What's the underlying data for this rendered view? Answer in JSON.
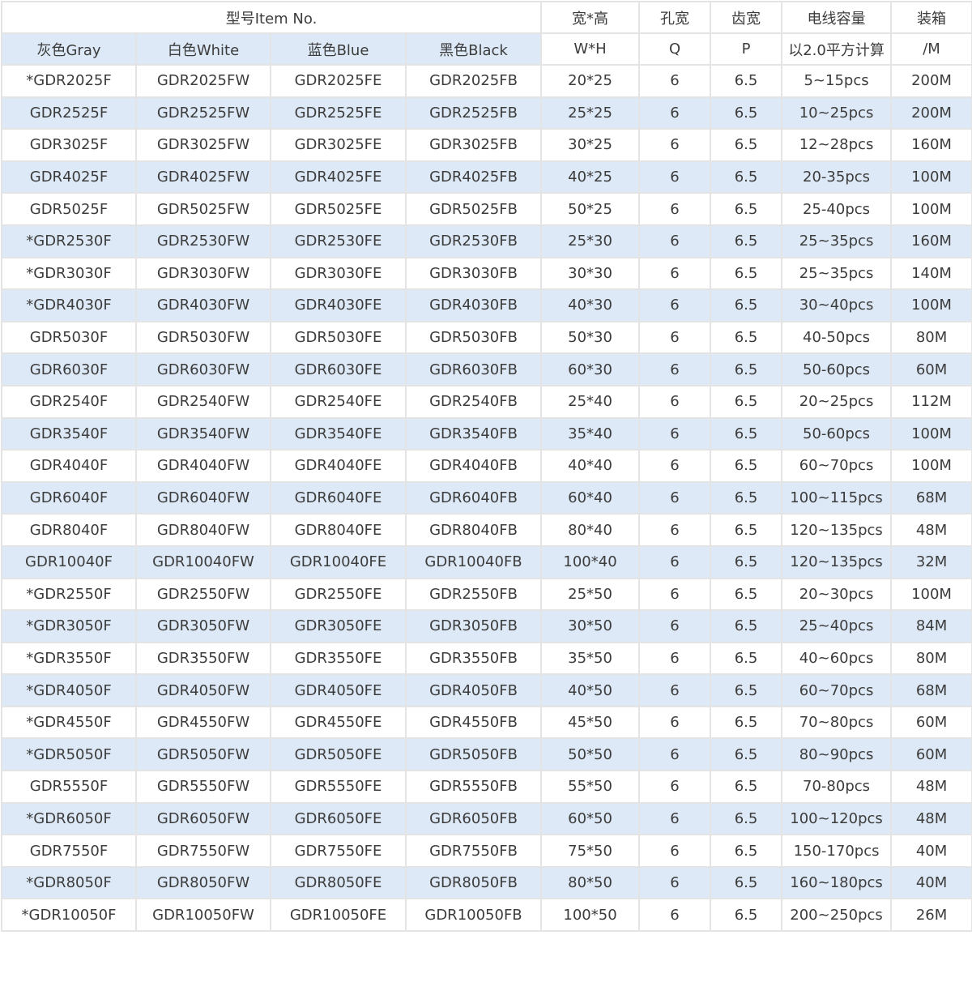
{
  "header": {
    "model_group": "型号Item No.",
    "gray": "灰色Gray",
    "white": "白色White",
    "blue": "蓝色Blue",
    "black": "黑色Black",
    "size_top": "宽*高",
    "size_bottom": "W*H",
    "hole_top": "孔宽",
    "hole_bottom": "Q",
    "tooth_top": "齿宽",
    "tooth_bottom": "P",
    "capacity_top": "电线容量",
    "capacity_bottom": "以2.0平方计算",
    "pack_top": "装箱",
    "pack_bottom": "/M"
  },
  "rows": [
    {
      "gray": "*GDR2025F",
      "white": "GDR2025FW",
      "blue": "GDR2025FE",
      "black": "GDR2025FB",
      "size": "20*25",
      "q": "6",
      "p": "6.5",
      "cap": "5~15pcs",
      "pack": "200M"
    },
    {
      "gray": "GDR2525F",
      "white": "GDR2525FW",
      "blue": "GDR2525FE",
      "black": "GDR2525FB",
      "size": "25*25",
      "q": "6",
      "p": "6.5",
      "cap": "10~25pcs",
      "pack": "200M"
    },
    {
      "gray": "GDR3025F",
      "white": "GDR3025FW",
      "blue": "GDR3025FE",
      "black": "GDR3025FB",
      "size": "30*25",
      "q": "6",
      "p": "6.5",
      "cap": "12~28pcs",
      "pack": "160M"
    },
    {
      "gray": "GDR4025F",
      "white": "GDR4025FW",
      "blue": "GDR4025FE",
      "black": "GDR4025FB",
      "size": "40*25",
      "q": "6",
      "p": "6.5",
      "cap": "20-35pcs",
      "pack": "100M"
    },
    {
      "gray": "GDR5025F",
      "white": "GDR5025FW",
      "blue": "GDR5025FE",
      "black": "GDR5025FB",
      "size": "50*25",
      "q": "6",
      "p": "6.5",
      "cap": "25-40pcs",
      "pack": "100M"
    },
    {
      "gray": "*GDR2530F",
      "white": "GDR2530FW",
      "blue": "GDR2530FE",
      "black": "GDR2530FB",
      "size": "25*30",
      "q": "6",
      "p": "6.5",
      "cap": "25~35pcs",
      "pack": "160M"
    },
    {
      "gray": "*GDR3030F",
      "white": "GDR3030FW",
      "blue": "GDR3030FE",
      "black": "GDR3030FB",
      "size": "30*30",
      "q": "6",
      "p": "6.5",
      "cap": "25~35pcs",
      "pack": "140M"
    },
    {
      "gray": "*GDR4030F",
      "white": "GDR4030FW",
      "blue": "GDR4030FE",
      "black": "GDR4030FB",
      "size": "40*30",
      "q": "6",
      "p": "6.5",
      "cap": "30~40pcs",
      "pack": "100M"
    },
    {
      "gray": "GDR5030F",
      "white": "GDR5030FW",
      "blue": "GDR5030FE",
      "black": "GDR5030FB",
      "size": "50*30",
      "q": "6",
      "p": "6.5",
      "cap": "40-50pcs",
      "pack": "80M"
    },
    {
      "gray": "GDR6030F",
      "white": "GDR6030FW",
      "blue": "GDR6030FE",
      "black": "GDR6030FB",
      "size": "60*30",
      "q": "6",
      "p": "6.5",
      "cap": "50-60pcs",
      "pack": "60M"
    },
    {
      "gray": "GDR2540F",
      "white": "GDR2540FW",
      "blue": "GDR2540FE",
      "black": "GDR2540FB",
      "size": "25*40",
      "q": "6",
      "p": "6.5",
      "cap": "20~25pcs",
      "pack": "112M"
    },
    {
      "gray": "GDR3540F",
      "white": "GDR3540FW",
      "blue": "GDR3540FE",
      "black": "GDR3540FB",
      "size": "35*40",
      "q": "6",
      "p": "6.5",
      "cap": "50-60pcs",
      "pack": "100M"
    },
    {
      "gray": "GDR4040F",
      "white": "GDR4040FW",
      "blue": "GDR4040FE",
      "black": "GDR4040FB",
      "size": "40*40",
      "q": "6",
      "p": "6.5",
      "cap": "60~70pcs",
      "pack": "100M"
    },
    {
      "gray": "GDR6040F",
      "white": "GDR6040FW",
      "blue": "GDR6040FE",
      "black": "GDR6040FB",
      "size": "60*40",
      "q": "6",
      "p": "6.5",
      "cap": "100~115pcs",
      "pack": "68M"
    },
    {
      "gray": "GDR8040F",
      "white": "GDR8040FW",
      "blue": "GDR8040FE",
      "black": "GDR8040FB",
      "size": "80*40",
      "q": "6",
      "p": "6.5",
      "cap": "120~135pcs",
      "pack": "48M"
    },
    {
      "gray": "GDR10040F",
      "white": "GDR10040FW",
      "blue": "GDR10040FE",
      "black": "GDR10040FB",
      "size": "100*40",
      "q": "6",
      "p": "6.5",
      "cap": "120~135pcs",
      "pack": "32M"
    },
    {
      "gray": "*GDR2550F",
      "white": "GDR2550FW",
      "blue": "GDR2550FE",
      "black": "GDR2550FB",
      "size": "25*50",
      "q": "6",
      "p": "6.5",
      "cap": "20~30pcs",
      "pack": "100M"
    },
    {
      "gray": "*GDR3050F",
      "white": "GDR3050FW",
      "blue": "GDR3050FE",
      "black": "GDR3050FB",
      "size": "30*50",
      "q": "6",
      "p": "6.5",
      "cap": "25~40pcs",
      "pack": "84M"
    },
    {
      "gray": "*GDR3550F",
      "white": "GDR3550FW",
      "blue": "GDR3550FE",
      "black": "GDR3550FB",
      "size": "35*50",
      "q": "6",
      "p": "6.5",
      "cap": "40~60pcs",
      "pack": "80M"
    },
    {
      "gray": "*GDR4050F",
      "white": "GDR4050FW",
      "blue": "GDR4050FE",
      "black": "GDR4050FB",
      "size": "40*50",
      "q": "6",
      "p": "6.5",
      "cap": "60~70pcs",
      "pack": "68M"
    },
    {
      "gray": "*GDR4550F",
      "white": "GDR4550FW",
      "blue": "GDR4550FE",
      "black": "GDR4550FB",
      "size": "45*50",
      "q": "6",
      "p": "6.5",
      "cap": "70~80pcs",
      "pack": "60M"
    },
    {
      "gray": "*GDR5050F",
      "white": "GDR5050FW",
      "blue": "GDR5050FE",
      "black": "GDR5050FB",
      "size": "50*50",
      "q": "6",
      "p": "6.5",
      "cap": "80~90pcs",
      "pack": "60M"
    },
    {
      "gray": "GDR5550F",
      "white": "GDR5550FW",
      "blue": "GDR5550FE",
      "black": "GDR5550FB",
      "size": "55*50",
      "q": "6",
      "p": "6.5",
      "cap": "70-80pcs",
      "pack": "48M"
    },
    {
      "gray": "*GDR6050F",
      "white": "GDR6050FW",
      "blue": "GDR6050FE",
      "black": "GDR6050FB",
      "size": "60*50",
      "q": "6",
      "p": "6.5",
      "cap": "100~120pcs",
      "pack": "48M"
    },
    {
      "gray": "GDR7550F",
      "white": "GDR7550FW",
      "blue": "GDR7550FE",
      "black": "GDR7550FB",
      "size": "75*50",
      "q": "6",
      "p": "6.5",
      "cap": "150-170pcs",
      "pack": "40M"
    },
    {
      "gray": "*GDR8050F",
      "white": "GDR8050FW",
      "blue": "GDR8050FE",
      "black": "GDR8050FB",
      "size": "80*50",
      "q": "6",
      "p": "6.5",
      "cap": "160~180pcs",
      "pack": "40M"
    },
    {
      "gray": "*GDR10050F",
      "white": "GDR10050FW",
      "blue": "GDR10050FE",
      "black": "GDR10050FB",
      "size": "100*50",
      "q": "6",
      "p": "6.5",
      "cap": "200~250pcs",
      "pack": "26M"
    }
  ],
  "colors": {
    "stripe": "#dde9f6",
    "border": "#e4e4e4",
    "text": "#3c3c3c"
  }
}
